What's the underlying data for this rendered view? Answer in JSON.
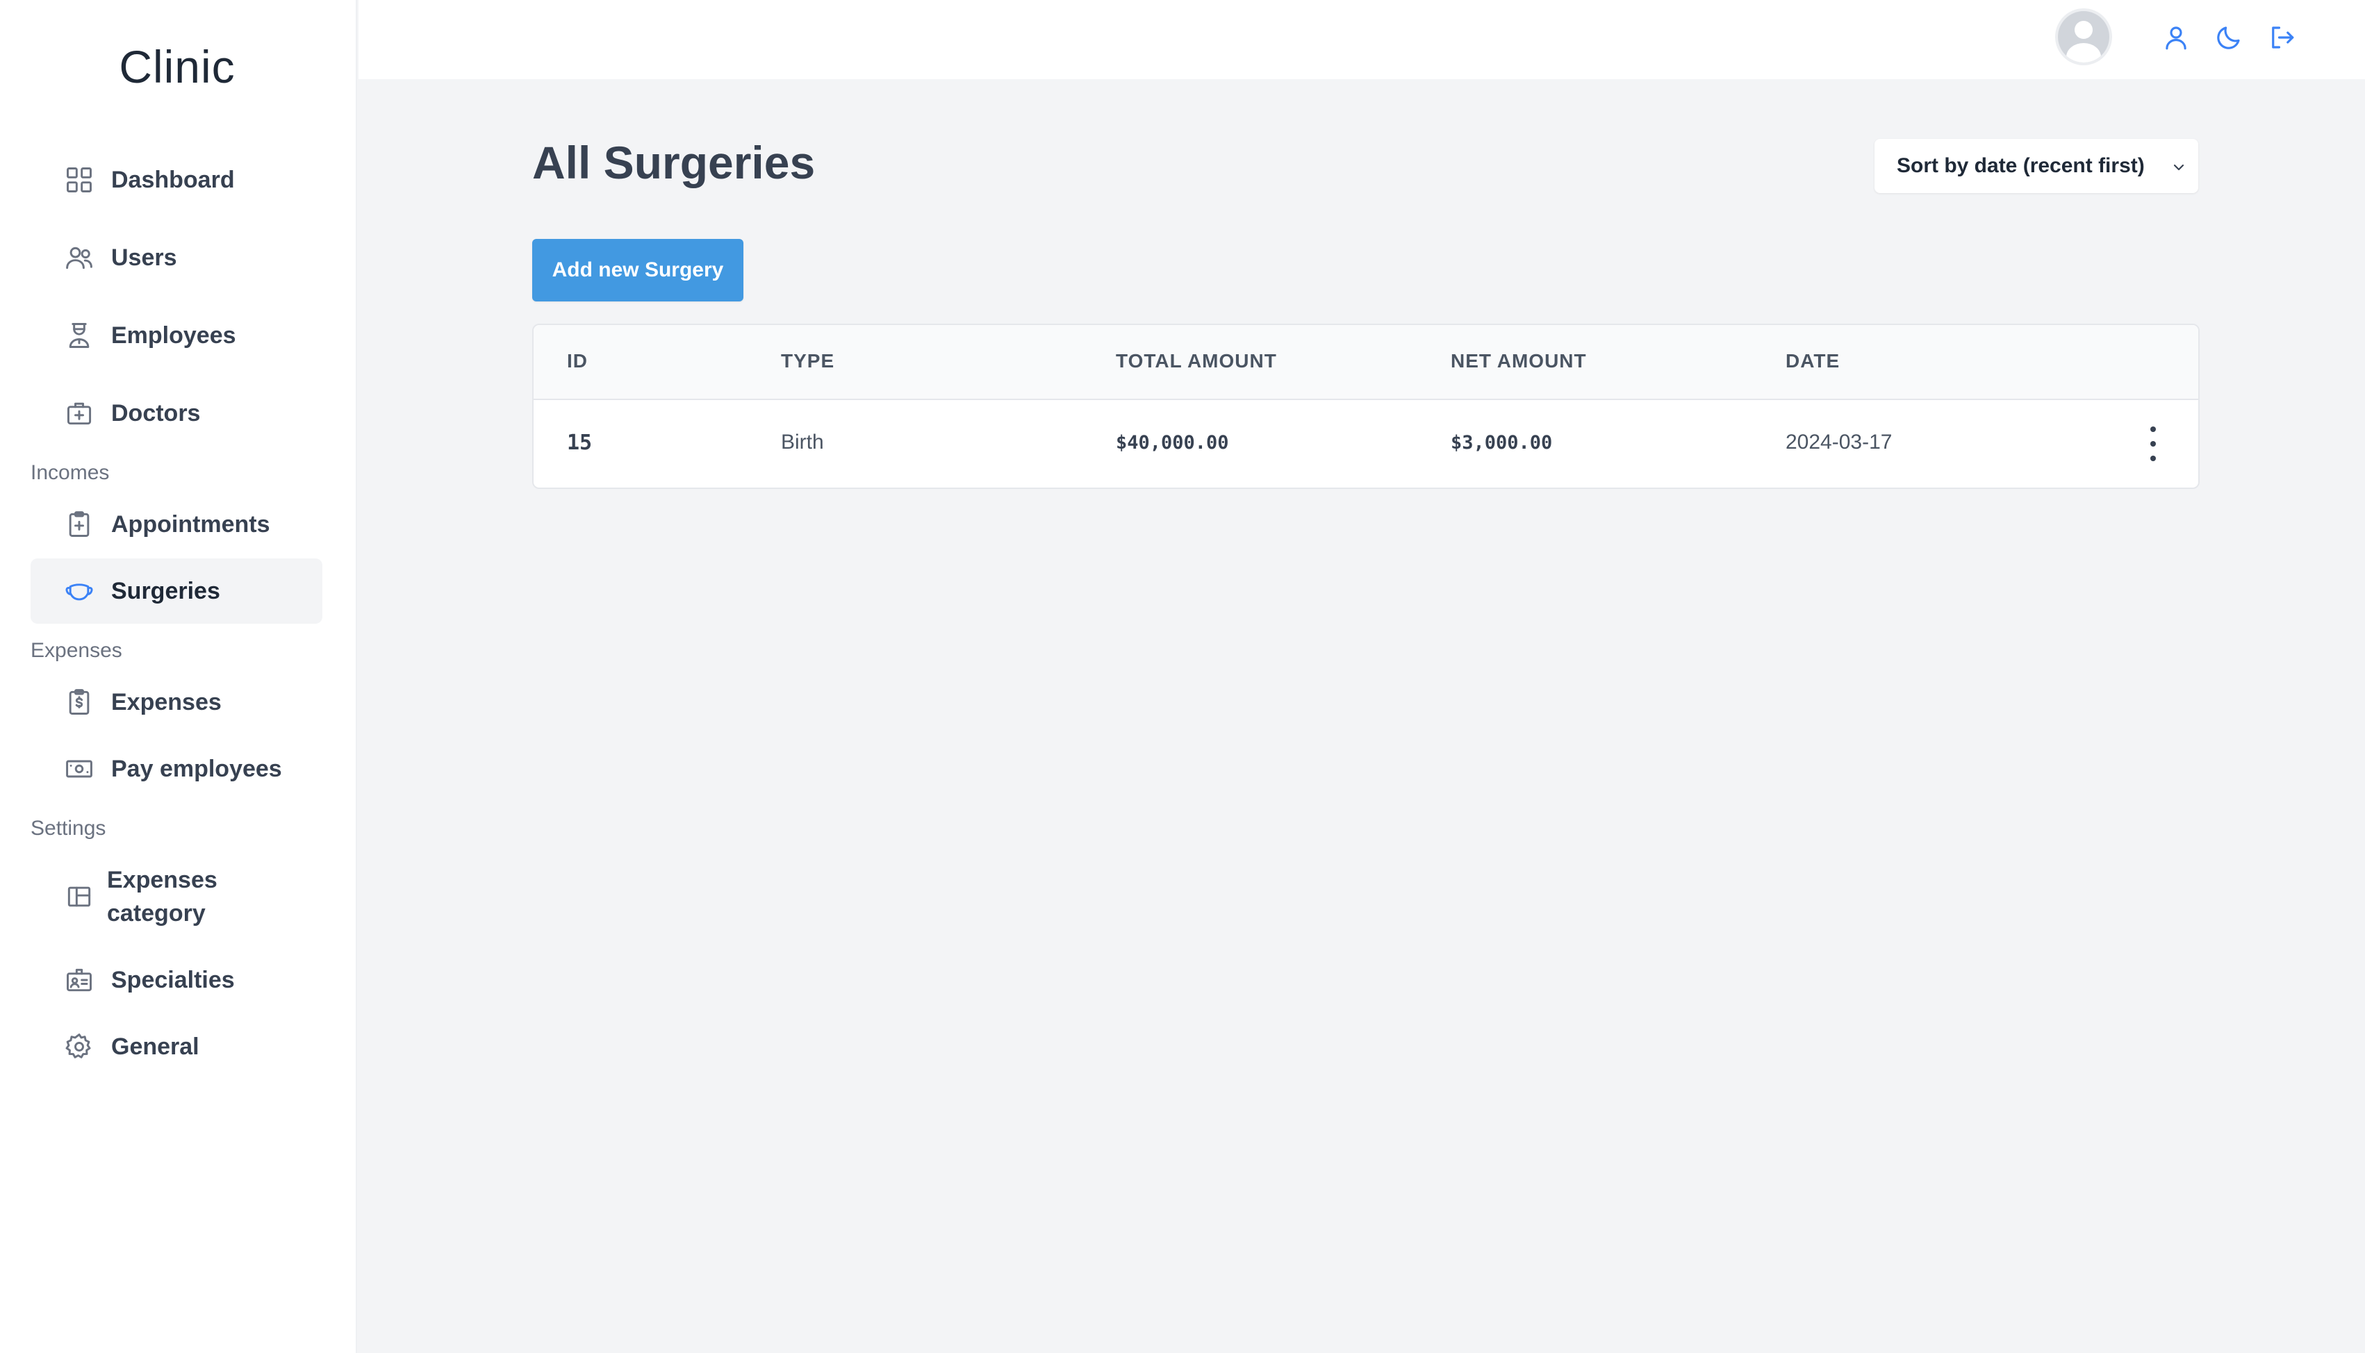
{
  "app": {
    "title": "Clinic"
  },
  "sidebar": {
    "items": [
      {
        "label": "Dashboard",
        "icon": "dashboard-grid-icon"
      },
      {
        "label": "Users",
        "icon": "users-icon"
      },
      {
        "label": "Employees",
        "icon": "employee-icon"
      },
      {
        "label": "Doctors",
        "icon": "medical-bag-icon"
      }
    ],
    "sections": [
      {
        "title": "Incomes",
        "items": [
          {
            "label": "Appointments",
            "icon": "clipboard-plus-icon"
          },
          {
            "label": "Surgeries",
            "icon": "surgical-mask-icon",
            "active": true
          }
        ]
      },
      {
        "title": "Expenses",
        "items": [
          {
            "label": "Expenses",
            "icon": "clipboard-dollar-icon"
          },
          {
            "label": "Pay employees",
            "icon": "banknote-icon"
          }
        ]
      },
      {
        "title": "Settings",
        "items": [
          {
            "label": "Expenses category",
            "icon": "layout-panel-icon"
          },
          {
            "label": "Specialties",
            "icon": "id-badge-icon"
          },
          {
            "label": "General",
            "icon": "gear-icon"
          }
        ]
      }
    ]
  },
  "header": {
    "icons": [
      "user-icon",
      "moon-icon",
      "logout-icon"
    ],
    "accent_color": "#3b82f6"
  },
  "main": {
    "page_title": "All Surgeries",
    "sort": {
      "selected": "Sort by date (recent first)"
    },
    "add_button_label": "Add new Surgery",
    "button_color": "#4299e1",
    "table": {
      "columns": [
        "ID",
        "TYPE",
        "TOTAL AMOUNT",
        "NET AMOUNT",
        "DATE"
      ],
      "rows": [
        {
          "id": "15",
          "type": "Birth",
          "total_amount": "$40,000.00",
          "net_amount": "$3,000.00",
          "date": "2024-03-17"
        }
      ]
    }
  }
}
